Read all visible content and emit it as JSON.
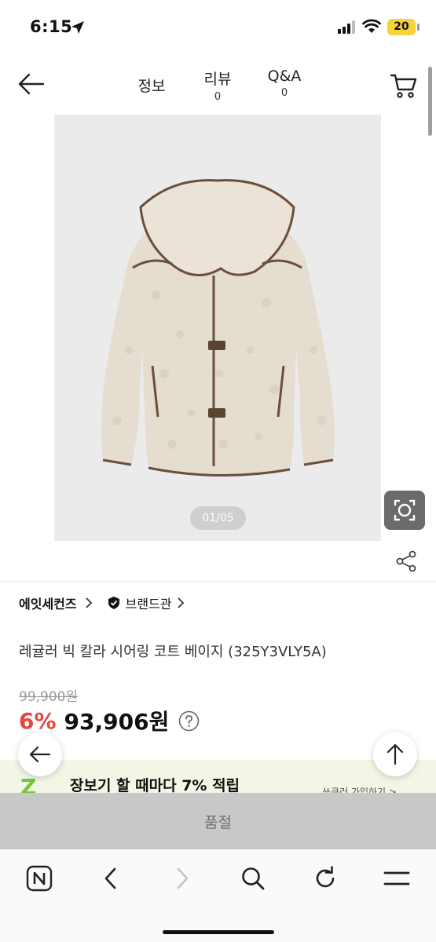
{
  "status_bar": {
    "time": "6:15",
    "battery": "20"
  },
  "header": {
    "tabs": [
      {
        "label": "정보",
        "count": ""
      },
      {
        "label": "리뷰",
        "count": "0"
      },
      {
        "label": "Q&A",
        "count": "0"
      }
    ]
  },
  "gallery": {
    "counter": "01/05"
  },
  "brand": {
    "name": "에잇세컨즈",
    "shop_label": "브랜드관"
  },
  "product": {
    "title": "레귤러 빅 칼라 시어링 코트 베이지 (325Y3VLY5A)",
    "original_price": "99,900원",
    "discount": "6%",
    "sale_price": "93,906원"
  },
  "promo": {
    "logo": "Z",
    "text": "장보기 할 때마다 7% 적립",
    "link": "쓰큰러 가입하기 >"
  },
  "purchase": {
    "soldout_label": "품절"
  },
  "colors": {
    "discount": "#e8473c",
    "soldout_bg": "#c8c8c8",
    "promo_bg": "#f2f6e6",
    "promo_green": "#74c53a",
    "battery": "#f7d23b"
  },
  "icons": [
    "location-arrow-icon",
    "signal-icon",
    "wifi-icon",
    "back-arrow-icon",
    "cart-icon",
    "lens-icon",
    "share-icon",
    "chevron-right-icon",
    "shield-check-icon",
    "question-icon",
    "arrow-up-icon",
    "n-logo-icon",
    "search-icon",
    "reload-icon",
    "menu-icon"
  ]
}
